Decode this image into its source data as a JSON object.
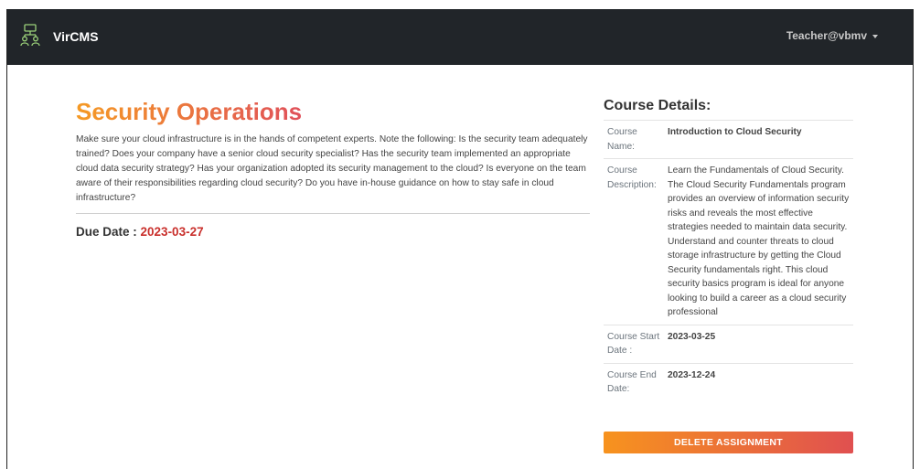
{
  "navbar": {
    "brand": "VirCMS",
    "logo_icon": "people-network-icon",
    "user": "Teacher@vbmv"
  },
  "assignment": {
    "title": "Security Operations",
    "description": "Make sure your cloud infrastructure is in the hands of competent experts. Note the following: Is the security team adequately trained? Does your company have a senior cloud security specialist? Has the security team implemented an appropriate cloud data security strategy? Has your organization adopted its security management to the cloud? Is everyone on the team aware of their responsibilities regarding cloud security? Do you have in-house guidance on how to stay safe in cloud infrastructure?",
    "due_label": "Due Date :",
    "due_date": "2023-03-27"
  },
  "course_details": {
    "heading": "Course Details:",
    "name_label": "Course Name:",
    "name": "Introduction to Cloud Security",
    "description_label": "Course Description:",
    "description": "Learn the Fundamentals of Cloud Security. The Cloud Security Fundamentals program provides an overview of information security risks and reveals the most effective strategies needed to maintain data security. Understand and counter threats to cloud storage infrastructure by getting the Cloud Security fundamentals right. This cloud security basics program is ideal for anyone looking to build a career as a cloud security professional",
    "start_label": "Course Start Date :",
    "start_date": "2023-03-25",
    "end_label": "Course End Date:",
    "end_date": "2023-12-24"
  },
  "actions": {
    "delete_label": "DELETE ASSIGNMENT"
  },
  "colors": {
    "navbar_bg": "#212529",
    "accent_orange": "#f7931e",
    "accent_red": "#e05050",
    "date_red": "#c9302c"
  }
}
